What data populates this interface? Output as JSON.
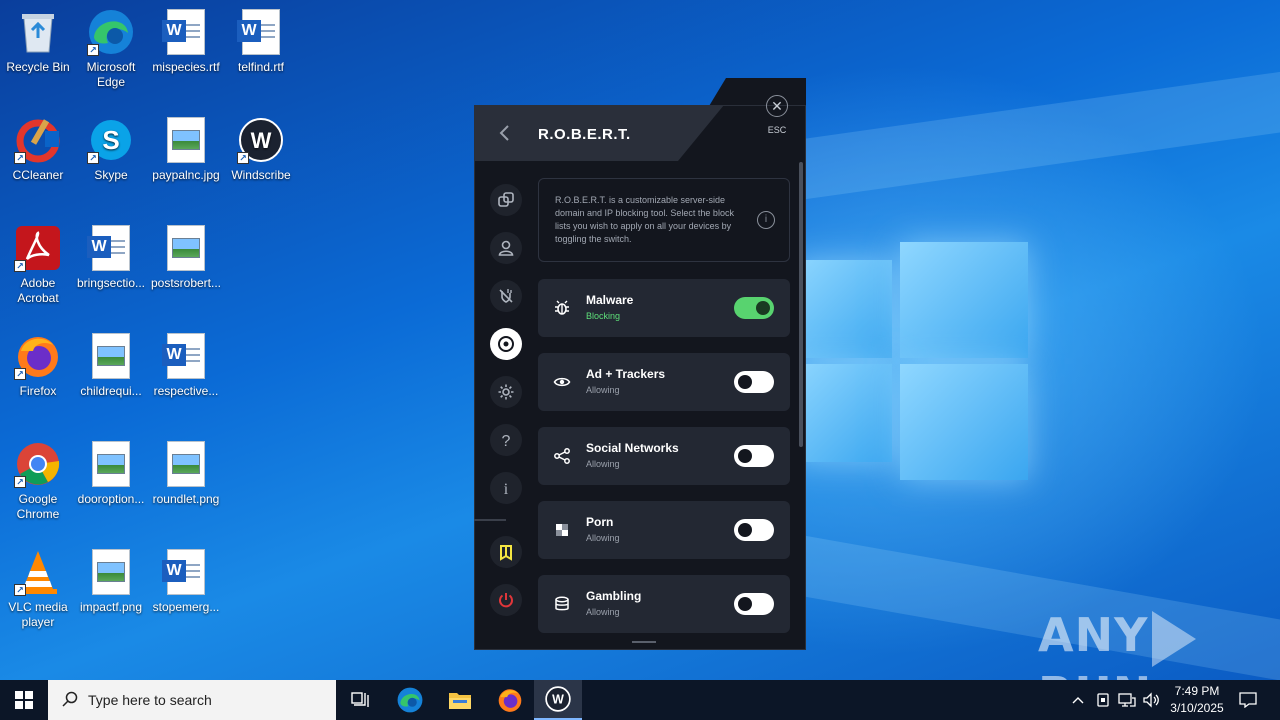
{
  "desktop": {
    "icons": [
      {
        "label": "Recycle Bin",
        "icon": "recycle-bin-icon"
      },
      {
        "label": "Microsoft Edge",
        "icon": "edge-icon"
      },
      {
        "label": "mispecies.rtf",
        "icon": "word-doc-icon"
      },
      {
        "label": "telfind.rtf",
        "icon": "word-doc-icon"
      },
      {
        "label": "CCleaner",
        "icon": "ccleaner-icon"
      },
      {
        "label": "Skype",
        "icon": "skype-icon"
      },
      {
        "label": "paypalnc.jpg",
        "icon": "image-file-icon"
      },
      {
        "label": "Windscribe",
        "icon": "windscribe-icon"
      },
      {
        "label": "Adobe Acrobat",
        "icon": "acrobat-icon"
      },
      {
        "label": "bringsectio...",
        "icon": "word-doc-icon"
      },
      {
        "label": "postsrobert...",
        "icon": "image-file-icon"
      },
      {
        "label": "Firefox",
        "icon": "firefox-icon"
      },
      {
        "label": "childrequi...",
        "icon": "image-file-icon"
      },
      {
        "label": "respective...",
        "icon": "word-doc-icon"
      },
      {
        "label": "Google Chrome",
        "icon": "chrome-icon"
      },
      {
        "label": "dooroption...",
        "icon": "image-file-icon"
      },
      {
        "label": "roundlet.png",
        "icon": "image-file-icon"
      },
      {
        "label": "VLC media player",
        "icon": "vlc-icon"
      },
      {
        "label": "impactf.png",
        "icon": "image-file-icon"
      },
      {
        "label": "stopemerg...",
        "icon": "word-doc-icon"
      }
    ]
  },
  "app": {
    "title": "R.O.B.E.R.T.",
    "esc_label": "ESC",
    "info_text": "R.O.B.E.R.T. is a customizable server-side domain and IP blocking tool. Select the block lists you wish to apply on all your devices by toggling the switch.",
    "sidebar": [
      {
        "icon": "connection-icon"
      },
      {
        "icon": "account-icon"
      },
      {
        "icon": "firewall-icon"
      },
      {
        "icon": "robert-icon",
        "active": true
      },
      {
        "icon": "settings-icon"
      },
      {
        "icon": "help-icon"
      },
      {
        "icon": "info-icon"
      },
      {
        "icon": "windscribe-logo-icon"
      },
      {
        "icon": "power-icon"
      }
    ],
    "lists": [
      {
        "title": "Malware",
        "status": "Blocking",
        "enabled": true,
        "icon": "bug-icon"
      },
      {
        "title": "Ad + Trackers",
        "status": "Allowing",
        "enabled": false,
        "icon": "eye-icon"
      },
      {
        "title": "Social Networks",
        "status": "Allowing",
        "enabled": false,
        "icon": "share-icon"
      },
      {
        "title": "Porn",
        "status": "Allowing",
        "enabled": false,
        "icon": "pixelated-icon"
      },
      {
        "title": "Gambling",
        "status": "Allowing",
        "enabled": false,
        "icon": "chips-icon"
      }
    ]
  },
  "watermark": {
    "left": "ANY",
    "right": "RUN"
  },
  "taskbar": {
    "search_placeholder": "Type here to search",
    "clock_time": "7:49 PM",
    "clock_date": "3/10/2025"
  },
  "colors": {
    "accent_green": "#58d36f",
    "app_bg": "#13161e",
    "row_bg": "#232833",
    "power_red": "#e0363a",
    "windscribe_yellow": "#f5e642"
  }
}
